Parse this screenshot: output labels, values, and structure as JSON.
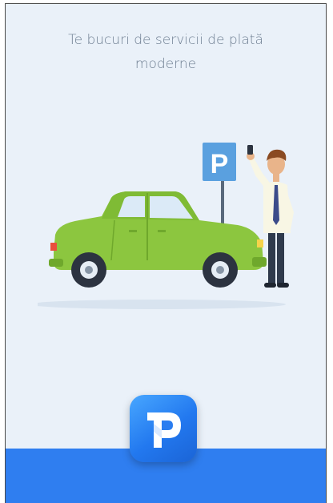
{
  "onboarding": {
    "headline_line1": "Te bucuri de servicii de plată",
    "headline_line2": "moderne"
  },
  "illustration": {
    "sign_letter": "P",
    "icons": [
      "parking-sign-icon",
      "car-icon",
      "person-with-phone-icon"
    ]
  },
  "app_icon": {
    "letter": "P",
    "icon": "parking-logo-icon"
  },
  "colors": {
    "background": "#eaf1f9",
    "headline": "#6f7f92",
    "accent_blue": "#2f7ef0",
    "car_green": "#8cc63f",
    "sign_blue": "#5aa0df"
  }
}
